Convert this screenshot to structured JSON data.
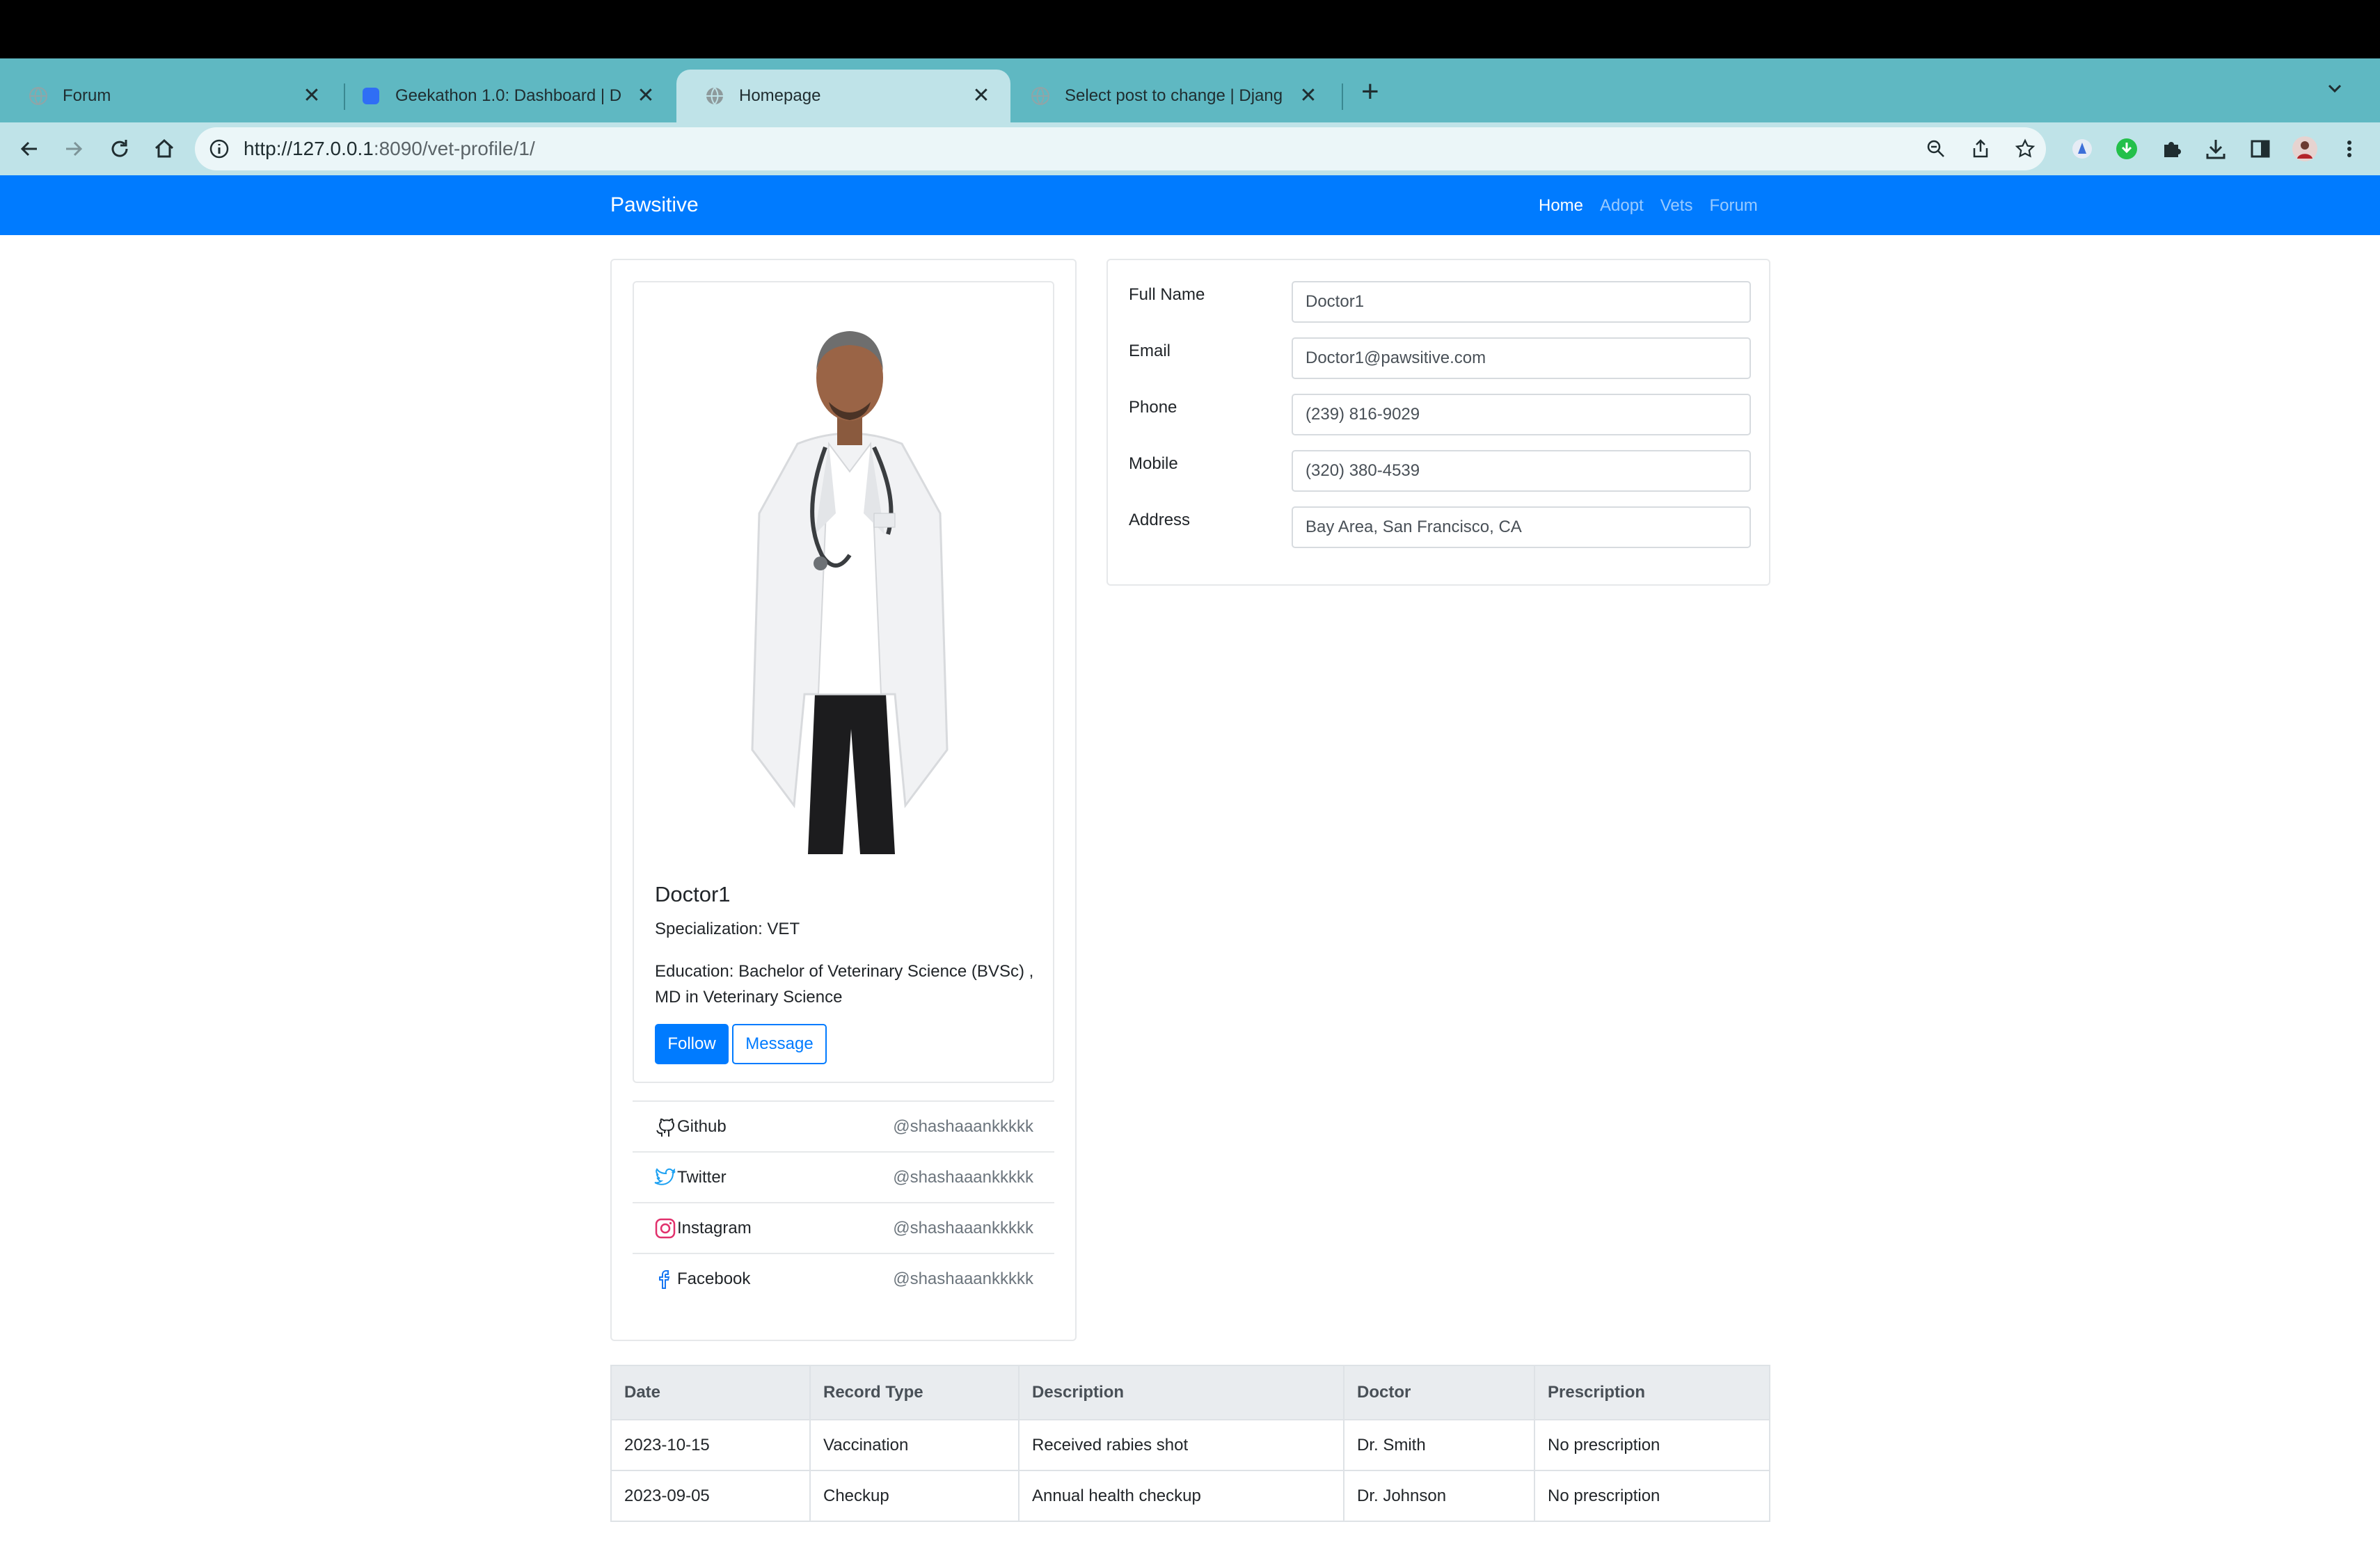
{
  "browser": {
    "tabs": [
      {
        "title": "Forum",
        "active": false
      },
      {
        "title": "Geekathon 1.0: Dashboard | D",
        "active": false
      },
      {
        "title": "Homepage",
        "active": true
      },
      {
        "title": "Select post to change | Djang",
        "active": false
      }
    ],
    "url_host": "http://127.0.0.1",
    "url_path": ":8090/vet-profile/1/"
  },
  "navbar": {
    "brand": "Pawsitive",
    "links": [
      "Home",
      "Adopt",
      "Vets",
      "Forum"
    ]
  },
  "profile": {
    "name": "Doctor1",
    "specialization": "Specialization: VET",
    "education": "Education: Bachelor of Veterinary Science (BVSc) , MD in Veterinary Science",
    "follow_label": "Follow",
    "message_label": "Message"
  },
  "social": [
    {
      "name": "Github",
      "handle": "@shashaaankkkkk"
    },
    {
      "name": "Twitter",
      "handle": "@shashaaankkkkk"
    },
    {
      "name": "Instagram",
      "handle": "@shashaaankkkkk"
    },
    {
      "name": "Facebook",
      "handle": "@shashaaankkkkk"
    }
  ],
  "details": {
    "full_name_label": "Full Name",
    "full_name": "Doctor1",
    "email_label": "Email",
    "email": "Doctor1@pawsitive.com",
    "phone_label": "Phone",
    "phone": "(239) 816-9029",
    "mobile_label": "Mobile",
    "mobile": "(320) 380-4539",
    "address_label": "Address",
    "address": "Bay Area, San Francisco, CA"
  },
  "records": {
    "headers": [
      "Date",
      "Record Type",
      "Description",
      "Doctor",
      "Prescription"
    ],
    "rows": [
      [
        "2023-10-15",
        "Vaccination",
        "Received rabies shot",
        "Dr. Smith",
        "No prescription"
      ],
      [
        "2023-09-05",
        "Checkup",
        "Annual health checkup",
        "Dr. Johnson",
        "No prescription"
      ]
    ]
  },
  "colors": {
    "primary": "#007bff",
    "tabstrip": "#5fb8c2",
    "toolbar": "#bfe3e8"
  }
}
